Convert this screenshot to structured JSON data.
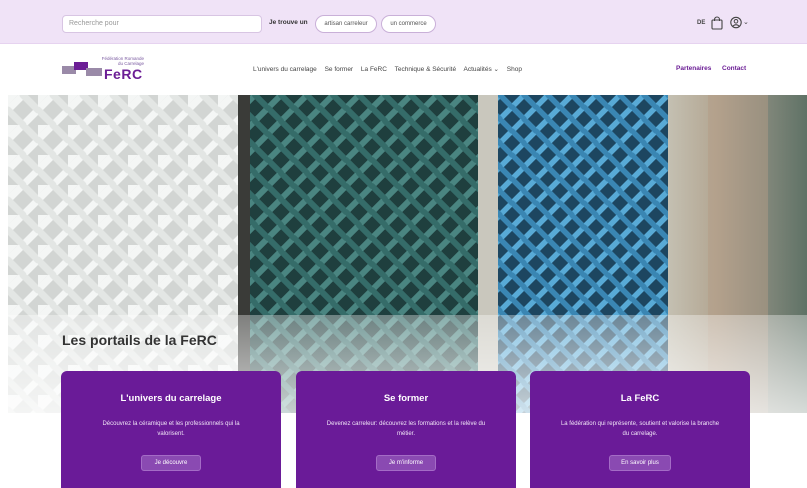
{
  "topbar": {
    "search_placeholder": "Recherche pour",
    "finder_label": "Je trouve un",
    "finder_options": [
      "artisan carreleur",
      "un commerce"
    ],
    "language": "DE",
    "icons": [
      "bag-icon",
      "user-icon",
      "chevron-down-icon"
    ]
  },
  "nav": {
    "logo_line1": "Fédération Romande",
    "logo_line2": "du Carrelage",
    "logo_text": "FeRC",
    "menu": [
      "L'univers du carrelage",
      "Se former",
      "La FeRC",
      "Technique & Sécurité",
      "Actualités ⌄",
      "Shop"
    ],
    "partners": "Partenaires",
    "contact": "Contact"
  },
  "portals": {
    "title": "Les portails de la FeRC",
    "cards": [
      {
        "title": "L'univers du carrelage",
        "text": "Découvrez la céramique et les professionnels qui la valorisent.",
        "button": "Je découvre"
      },
      {
        "title": "Se former",
        "text": "Devenez carreleur: découvrez les formations et la relève du métier.",
        "button": "Je m'informe"
      },
      {
        "title": "La FeRC",
        "text": "La fédération qui représente, soutient et valorise la branche du carrelage.",
        "button": "En savoir plus"
      }
    ]
  },
  "colors": {
    "brand_purple": "#6a1b98",
    "topbar_bg": "#f0e3f7",
    "tile_white": "#eceeed",
    "tile_teal": "#3e7774",
    "tile_blue": "#3f93c3",
    "tile_grey": "#aaa9a2"
  }
}
